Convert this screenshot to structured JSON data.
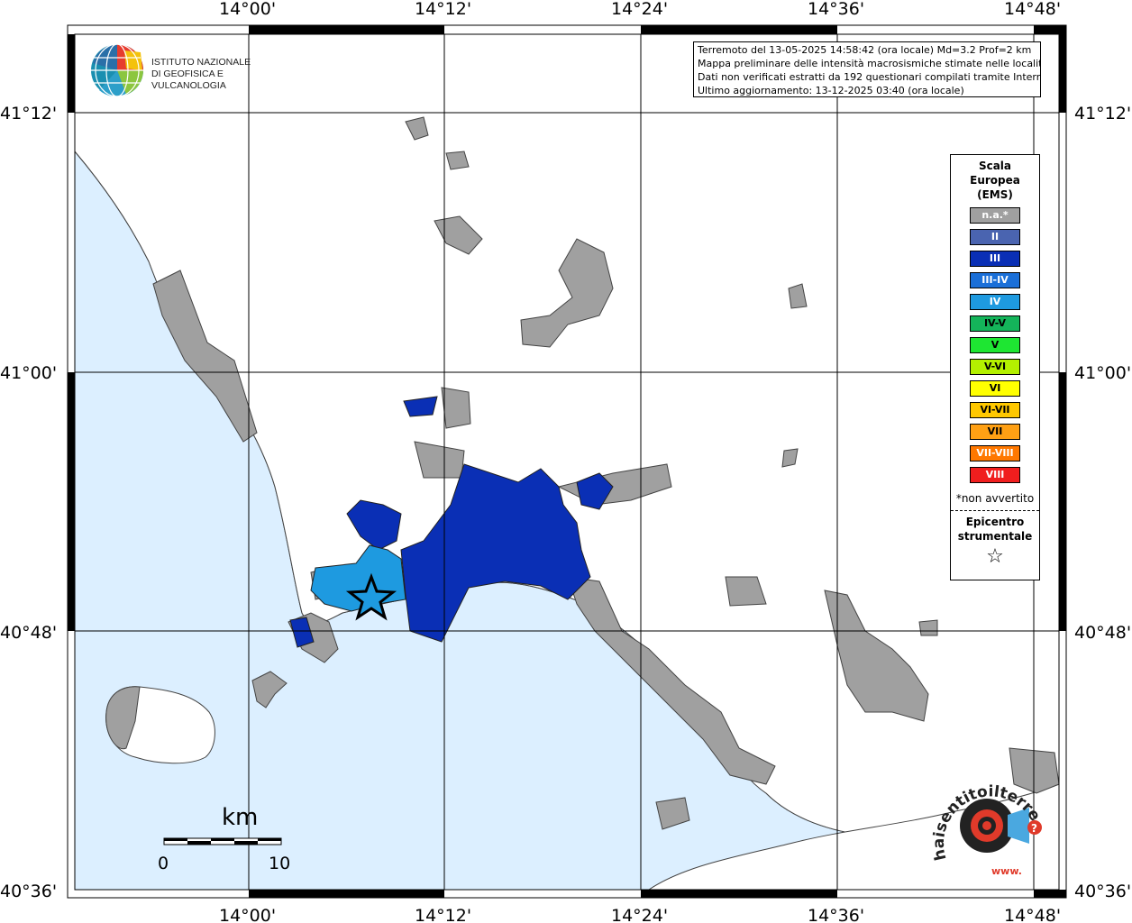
{
  "header": {
    "line1": "Terremoto del 13-05-2025 14:58:42 (ora locale) Md=3.2 Prof=2 km",
    "line2": "Mappa preliminare delle intensità macrosismiche stimate nelle località",
    "line3": "Dati non verificati estratti da 192 questionari compilati tramite Internet.",
    "line4": "Ultimo aggiornamento: 13-12-2025 03:40 (ora locale)"
  },
  "institute": {
    "line1": "ISTITUTO NAZIONALE",
    "line2": "DI GEOFISICA E VULCANOLOGIA"
  },
  "axes": {
    "lon_labels": [
      "14°00'",
      "14°12'",
      "14°24'",
      "14°36'",
      "14°48'"
    ],
    "lat_labels": [
      "41°12'",
      "41°00'",
      "40°48'",
      "40°36'"
    ]
  },
  "legend": {
    "title_line1": "Scala",
    "title_line2": "Europea",
    "title_line3": "(EMS)",
    "items": [
      {
        "label": "n.a.*",
        "color": "#a0a0a0"
      },
      {
        "label": "II",
        "color": "#4a64b0"
      },
      {
        "label": "III",
        "color": "#0a2fb5"
      },
      {
        "label": "III-IV",
        "color": "#1a6fd8"
      },
      {
        "label": "IV",
        "color": "#1e9ae0"
      },
      {
        "label": "IV-V",
        "color": "#14b45a"
      },
      {
        "label": "V",
        "color": "#1ee632"
      },
      {
        "label": "V-VI",
        "color": "#b4f000"
      },
      {
        "label": "VI",
        "color": "#ffff00"
      },
      {
        "label": "VI-VII",
        "color": "#ffc800"
      },
      {
        "label": "VII",
        "color": "#ffa014"
      },
      {
        "label": "VII-VIII",
        "color": "#ff7800"
      },
      {
        "label": "VIII",
        "color": "#f01e1e"
      }
    ],
    "note": "*non avvertito",
    "epicenter_line1": "Epicentro",
    "epicenter_line2": "strumentale",
    "epicenter_symbol": "☆"
  },
  "scalebar": {
    "unit": "km",
    "min_label": "0",
    "max_label": "10"
  },
  "watermark": {
    "text": "haisentitoilterremoto.it ?",
    "url": "www."
  },
  "colors": {
    "sea": "#dcefff",
    "land_na": "#a0a0a0",
    "intensity_III": "#0a2fb5",
    "intensity_IV": "#1e9ae0"
  }
}
